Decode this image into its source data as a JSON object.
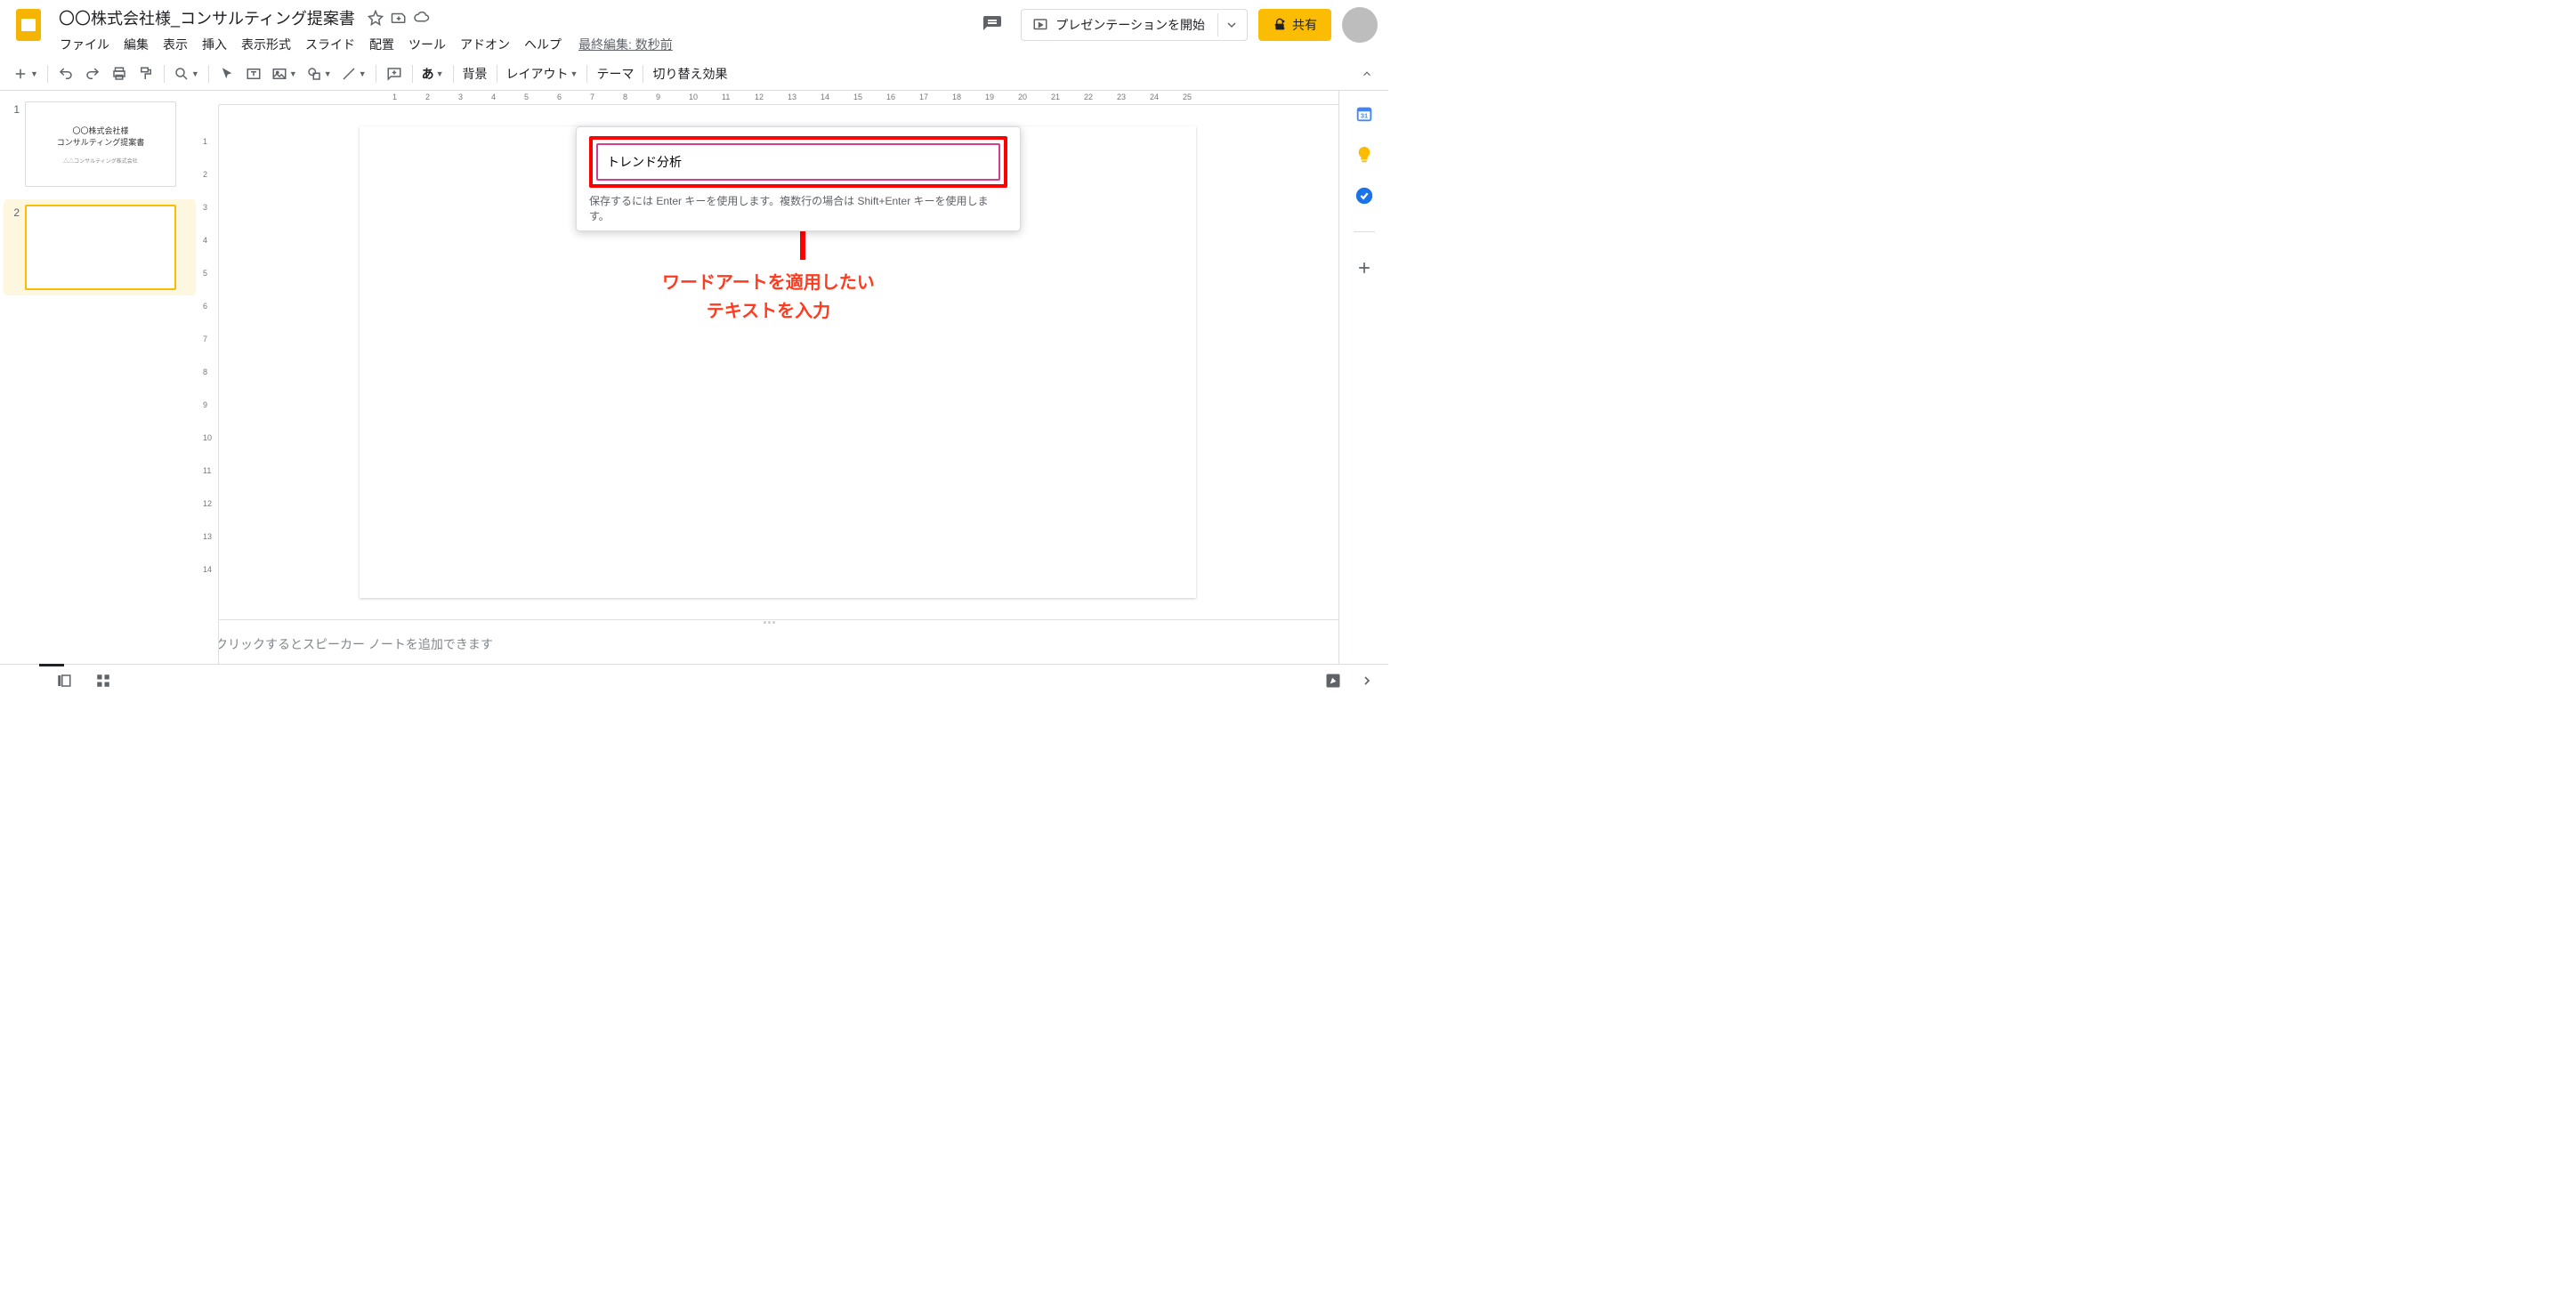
{
  "header": {
    "doc_title": "〇〇株式会社様_コンサルティング提案書",
    "last_edit": "最終編集: 数秒前",
    "present_label": "プレゼンテーションを開始",
    "share_label": "共有"
  },
  "menubar": [
    "ファイル",
    "編集",
    "表示",
    "挿入",
    "表示形式",
    "スライド",
    "配置",
    "ツール",
    "アドオン",
    "ヘルプ"
  ],
  "toolbar": {
    "text_char": "あ",
    "background": "背景",
    "layout": "レイアウト",
    "theme": "テーマ",
    "transition": "切り替え効果"
  },
  "filmstrip": {
    "slides": [
      {
        "num": "1",
        "title_l1": "〇〇株式会社様",
        "title_l2": "コンサルティング提案書",
        "subtitle": "△△コンサルティング株式会社"
      },
      {
        "num": "2",
        "title_l1": "",
        "title_l2": "",
        "subtitle": ""
      }
    ]
  },
  "ruler_h": [
    "1",
    "2",
    "3",
    "4",
    "5",
    "6",
    "7",
    "8",
    "9",
    "10",
    "11",
    "12",
    "13",
    "14",
    "15",
    "16",
    "17",
    "18",
    "19",
    "20",
    "21",
    "22",
    "23",
    "24",
    "25"
  ],
  "ruler_v": [
    "1",
    "2",
    "3",
    "4",
    "5",
    "6",
    "7",
    "8",
    "9",
    "10",
    "11",
    "12",
    "13",
    "14"
  ],
  "wordart": {
    "input_value": "トレンド分析",
    "hint": "保存するには Enter キーを使用します。複数行の場合は Shift+Enter キーを使用します。"
  },
  "annotation": {
    "line1": "ワードアートを適用したい",
    "line2": "テキストを入力"
  },
  "notes": {
    "placeholder": "クリックするとスピーカー ノートを追加できます"
  },
  "sidepanel": {
    "calendar_day": "31"
  }
}
